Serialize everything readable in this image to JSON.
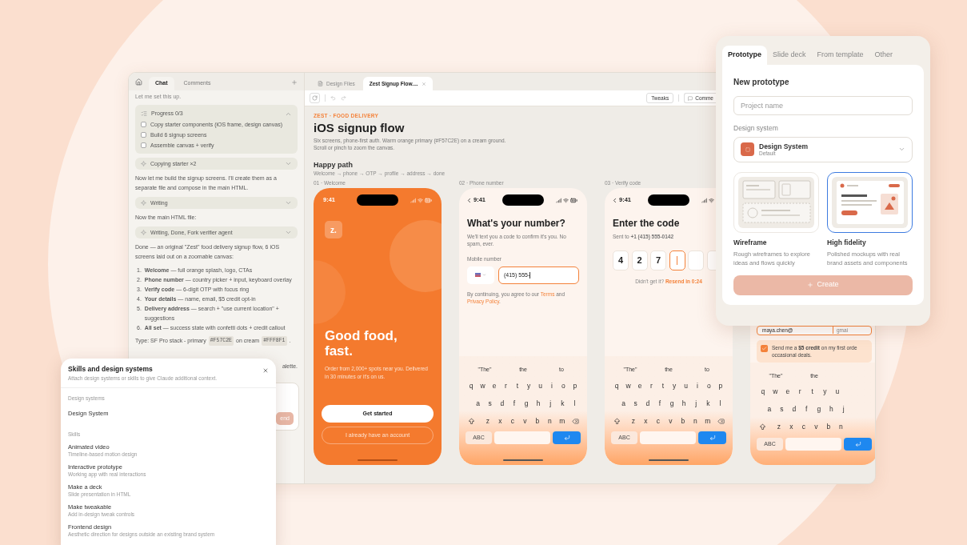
{
  "chat": {
    "tabs": [
      {
        "label": "Chat",
        "selected": true
      },
      {
        "label": "Comments",
        "selected": false
      }
    ],
    "intro": "Let me set this up.",
    "progress": {
      "title": "Progress 0/3",
      "expanded": true,
      "items": [
        {
          "label": "Copy starter components (iOS frame, design canvas)",
          "checked": false
        },
        {
          "label": "Build 6 signup screens",
          "checked": false
        },
        {
          "label": "Assemble canvas + verify",
          "checked": false
        }
      ]
    },
    "blocks": [
      {
        "kind": "step",
        "label": "Copying starter ×2",
        "expanded": false
      },
      {
        "kind": "text",
        "text": "Now let me build the signup screens. I'll create them as a separate file and compose in the main HTML."
      },
      {
        "kind": "step",
        "label": "Writing",
        "expanded": false
      },
      {
        "kind": "text",
        "text": "Now the main HTML file:"
      },
      {
        "kind": "step",
        "label": "Writing, Done, Fork verifier agent",
        "expanded": false
      },
      {
        "kind": "text",
        "text": "Done — an original \"Zest\" food delivery signup flow, 6 iOS screens laid out on a zoomable canvas:"
      }
    ],
    "list": [
      {
        "number": "1.",
        "text": "**Welcome** — full orange splash, logo, CTAs"
      },
      {
        "number": "2.",
        "text": "**Phone number** — country picker + input, keyboard overlay"
      },
      {
        "number": "3.",
        "text": "**Verify code** — 6-digit OTP with focus ring"
      },
      {
        "number": "4.",
        "text": "**Your details** — name, email, $5 credit opt-in"
      },
      {
        "number": "5.",
        "text": "**Delivery address** — search + \"use current location\" + suggestions"
      },
      {
        "number": "6.",
        "text": "**All set** — success state with confetti dots + credit callout"
      }
    ],
    "type_line": [
      {
        "kind": "text",
        "text": "Type: SF Pro stack - primary"
      },
      {
        "kind": "code",
        "text": "#F57C2E"
      },
      {
        "kind": "text",
        "text": "on cream"
      },
      {
        "kind": "code",
        "text": "#FFF8F1"
      },
      {
        "kind": "text",
        "text": "."
      }
    ],
    "fragment": "alette.",
    "send_button": "end"
  },
  "canvas": {
    "file_tabs": [
      {
        "label": "Design Files",
        "selected": false
      },
      {
        "label": "Zest Signup Flow....",
        "selected": true
      }
    ],
    "toolbar": {
      "tweaks": "Tweaks",
      "comments": "Comme"
    },
    "eyebrow": "ZEST · FOOD DELIVERY",
    "title": "iOS signup flow",
    "description_lines": [
      "Six screens, phone-first auth. Warm orange primary (#F57C2E) on a cream ground.",
      "Scroll or pinch to zoom the canvas."
    ],
    "section": {
      "title": "Happy path",
      "flow": "Welcome → phone → OTP → profile → address → done"
    },
    "phones": [
      {
        "kind": "welcome",
        "label": "01 · Welcome",
        "time": "9:41",
        "logo": "z.",
        "headline": "Good food, fast.",
        "subtitle": "Order from 2,000+ spots near you. Delivered in 30 minutes or it's on us.",
        "primary": "Get started",
        "secondary": "I already have an account"
      },
      {
        "kind": "phone",
        "label": "02 · Phone number",
        "time": "9:41",
        "title": "What's your number?",
        "subtitle": "We'll text you a code to confirm it's you. No spam, ever.",
        "field_label": "Mobile number",
        "value": "(415) 555-",
        "legal": {
          "before": "By continuing, you agree to our",
          "terms": "Terms",
          "middle": "and",
          "privacy": "Privacy Policy",
          "after": "."
        },
        "keyboard": {
          "suggestions": [
            "\"The\"",
            "the",
            "to"
          ],
          "rows": [
            {
              "keys": [
                "q",
                "w",
                "e",
                "r",
                "t",
                "y",
                "u",
                "i",
                "o",
                "p"
              ]
            },
            {
              "keys": [
                "a",
                "s",
                "d",
                "f",
                "g",
                "h",
                "j",
                "k",
                "l"
              ]
            },
            {
              "keys": [
                "z",
                "x",
                "c",
                "v",
                "b",
                "n",
                "m"
              ]
            }
          ],
          "abc": "ABC"
        }
      },
      {
        "kind": "verify",
        "label": "03 · Verify code",
        "time": "9:41",
        "title": "Enter the code",
        "sent": "Sent to **+1 (415) 555-0142**",
        "otp": [
          {
            "digit": "4",
            "focused": false
          },
          {
            "digit": "2",
            "focused": false
          },
          {
            "digit": "7",
            "focused": false
          },
          {
            "focused": true
          },
          {
            "focused": false
          },
          {
            "focused": false
          }
        ],
        "resend_prompt": "Didn't get it?",
        "resend": "Resend in 0:24",
        "keyboard": {
          "suggestions": [
            "\"The\"",
            "the",
            "to"
          ],
          "rows": [
            {
              "keys": [
                "q",
                "w",
                "e",
                "r",
                "t",
                "y",
                "u",
                "i",
                "o",
                "p"
              ]
            },
            {
              "keys": [
                "a",
                "s",
                "d",
                "f",
                "g",
                "h",
                "j",
                "k",
                "l"
              ]
            },
            {
              "keys": [
                "z",
                "x",
                "c",
                "v",
                "b",
                "n",
                "m"
              ]
            }
          ],
          "abc": "ABC"
        }
      },
      {
        "kind": "details",
        "email": "maya.chen@",
        "domain": "gmai",
        "opt_in": {
          "checked": true,
          "lines": [
            "Send me a **$5 credit** on my first orde",
            "occasional deals."
          ]
        },
        "keyboard": {
          "suggestions": [
            "\"The\"",
            "the"
          ],
          "rows": [
            {
              "keys": [
                "q",
                "w",
                "e",
                "r",
                "t",
                "y",
                "u"
              ]
            },
            {
              "keys": [
                "a",
                "s",
                "d",
                "f",
                "g",
                "h",
                "j"
              ]
            },
            {
              "keys": [
                "z",
                "x",
                "c",
                "v",
                "b",
                "n"
              ]
            }
          ],
          "abc": "ABC"
        }
      }
    ]
  },
  "new_dialog": {
    "tabs": [
      {
        "label": "Prototype",
        "selected": true
      },
      {
        "label": "Slide deck",
        "selected": false
      },
      {
        "label": "From template",
        "selected": false
      },
      {
        "label": "Other",
        "selected": false
      }
    ],
    "heading": "New prototype",
    "name_placeholder": "Project name",
    "design_label": "Design system",
    "design": {
      "name": "Design System",
      "note": "Default"
    },
    "options": [
      {
        "kind": "wireframe",
        "title": "Wireframe",
        "description": "Rough wireframes to explore ideas and flows quickly",
        "selected": false
      },
      {
        "kind": "hifi",
        "title": "High fidelity",
        "description": "Polished mockups with real brand assets and components",
        "selected": true
      }
    ],
    "create": {
      "label": "Create",
      "disabled": true
    }
  },
  "skills_dialog": {
    "title": "Skills and design systems",
    "subtitle": "Attach design systems or skills to give Claude additional context.",
    "sections": [
      {
        "heading": "Design systems",
        "items": [
          {
            "name": "Design System"
          }
        ]
      },
      {
        "heading": "Skills",
        "items": [
          {
            "name": "Animated video",
            "description": "Timeline-based motion design"
          },
          {
            "name": "Interactive prototype",
            "description": "Working app with real interactions"
          },
          {
            "name": "Make a deck",
            "description": "Slide presentation in HTML"
          },
          {
            "name": "Make tweakable",
            "description": "Add in-design tweak controls"
          },
          {
            "name": "Frontend design",
            "description": "Aesthetic direction for designs outside an existing brand system"
          }
        ]
      }
    ]
  }
}
